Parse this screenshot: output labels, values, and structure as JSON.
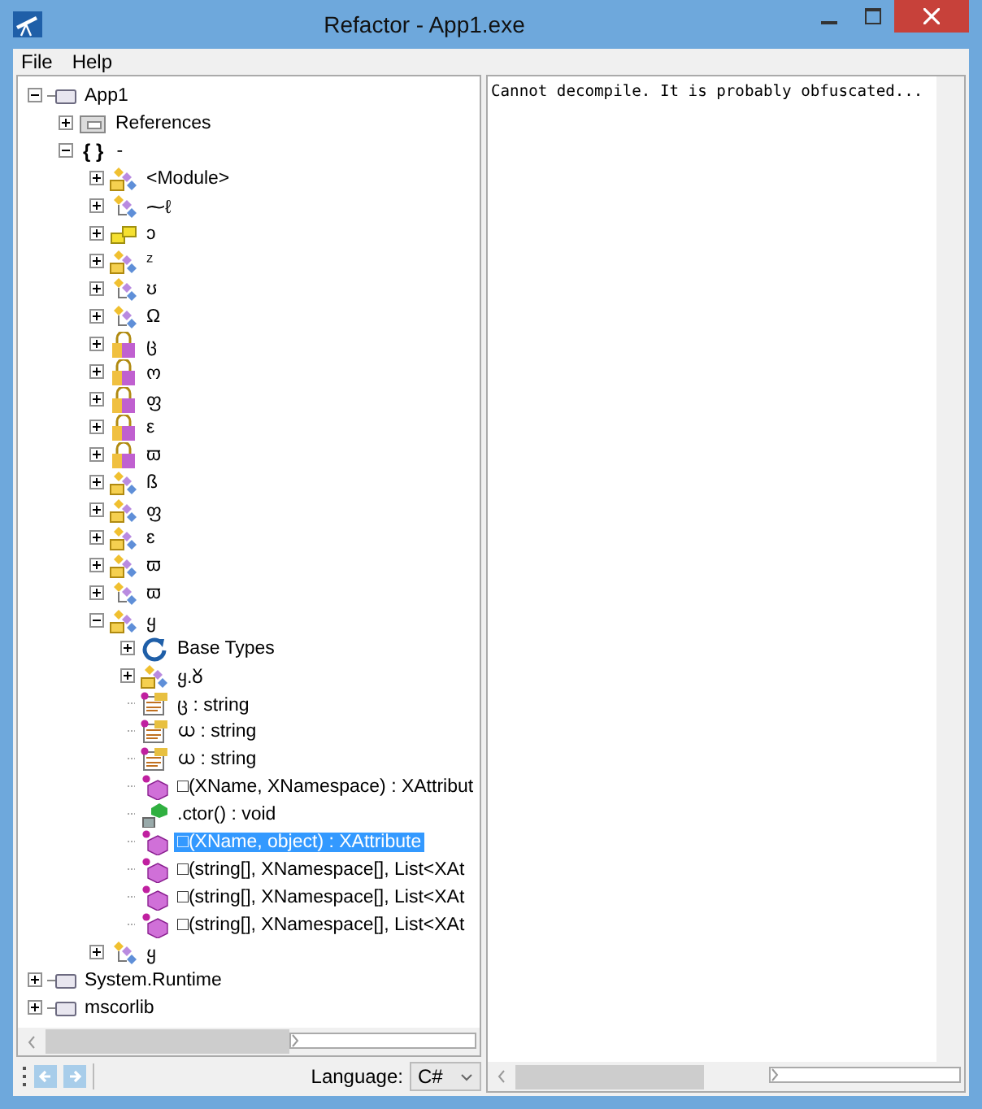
{
  "window": {
    "title": "Refactor - App1.exe"
  },
  "menu": [
    "File",
    "Help"
  ],
  "tree": [
    {
      "label": "App1",
      "kind": "assembly",
      "expanded": true,
      "selected": false,
      "children": [
        {
          "label": "References",
          "kind": "references",
          "expanded": false,
          "selected": false
        },
        {
          "label": "-",
          "kind": "namespace",
          "glyph": "{ }",
          "expanded": true,
          "selected": false,
          "children": [
            {
              "label": "<Module>",
              "kind": "class-box",
              "expanded": false,
              "selected": false
            },
            {
              "label": "⁓ℓ",
              "kind": "class",
              "expanded": false,
              "selected": false
            },
            {
              "label": "ɔ",
              "kind": "struct",
              "expanded": false,
              "selected": false
            },
            {
              "label": "ᶻ",
              "kind": "class-box",
              "expanded": false,
              "selected": false
            },
            {
              "label": "ʊ",
              "kind": "class",
              "expanded": false,
              "selected": false
            },
            {
              "label": "Ω",
              "kind": "class",
              "expanded": false,
              "selected": false
            },
            {
              "label": "ც",
              "kind": "locked",
              "expanded": false,
              "selected": false
            },
            {
              "label": "ო",
              "kind": "locked",
              "expanded": false,
              "selected": false
            },
            {
              "label": "ფ",
              "kind": "locked",
              "expanded": false,
              "selected": false
            },
            {
              "label": "ε",
              "kind": "locked",
              "expanded": false,
              "selected": false
            },
            {
              "label": "ϖ",
              "kind": "locked",
              "expanded": false,
              "selected": false
            },
            {
              "label": "ß",
              "kind": "class-box",
              "expanded": false,
              "selected": false
            },
            {
              "label": "ფ",
              "kind": "class-box",
              "expanded": false,
              "selected": false
            },
            {
              "label": "ɛ",
              "kind": "class-box",
              "expanded": false,
              "selected": false
            },
            {
              "label": "ϖ",
              "kind": "class-box",
              "expanded": false,
              "selected": false
            },
            {
              "label": "ϖ",
              "kind": "class",
              "expanded": false,
              "selected": false
            },
            {
              "label": "ყ",
              "kind": "class-box",
              "expanded": true,
              "selected": false,
              "children": [
                {
                  "label": "Base Types",
                  "kind": "base-types",
                  "expanded": false,
                  "selected": false
                },
                {
                  "label": "ყ.ᲈ",
                  "kind": "class-box",
                  "expanded": false,
                  "selected": false
                },
                {
                  "label": "ც : string",
                  "kind": "field",
                  "selected": false
                },
                {
                  "label": "ധ : string",
                  "kind": "field",
                  "selected": false
                },
                {
                  "label": "ധ : string",
                  "kind": "field",
                  "selected": false
                },
                {
                  "label": "□(XName, XNamespace) : XAttribut",
                  "kind": "method",
                  "selected": false
                },
                {
                  "label": ".ctor() : void",
                  "kind": "ctor",
                  "selected": false
                },
                {
                  "label": "□(XName, object) : XAttribute",
                  "kind": "method",
                  "selected": true
                },
                {
                  "label": "□(string[], XNamespace[], List<XAt",
                  "kind": "method",
                  "selected": false
                },
                {
                  "label": "□(string[], XNamespace[], List<XAt",
                  "kind": "method",
                  "selected": false
                },
                {
                  "label": "□(string[], XNamespace[], List<XAt",
                  "kind": "method",
                  "selected": false
                }
              ]
            },
            {
              "label": "ყ",
              "kind": "class",
              "expanded": false,
              "selected": false
            }
          ]
        }
      ]
    },
    {
      "label": "System.Runtime",
      "kind": "assembly",
      "expanded": false,
      "selected": false
    },
    {
      "label": "mscorlib",
      "kind": "assembly",
      "expanded": false,
      "selected": false
    }
  ],
  "language": {
    "label": "Language:",
    "value": "C#"
  },
  "output": "Cannot decompile. It is probably obfuscated..."
}
